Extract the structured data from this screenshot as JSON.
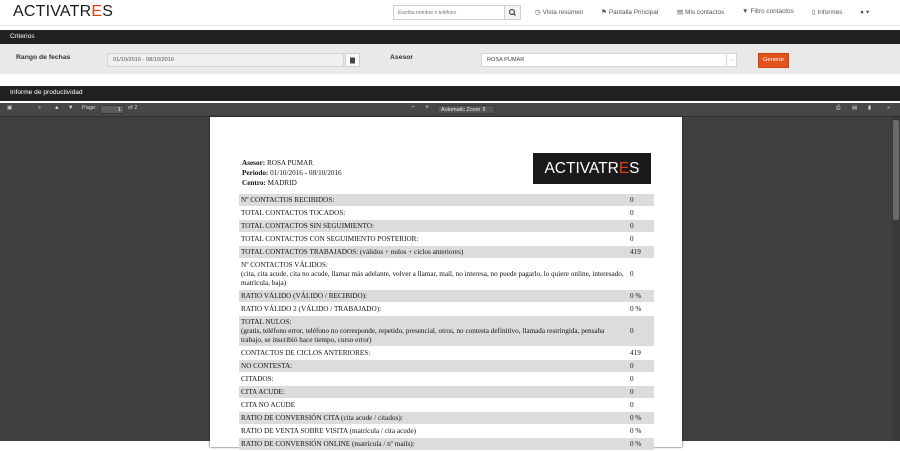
{
  "navbar": {
    "logo_main": "ACTIVATR",
    "logo_accent": "E",
    "logo_tail": "S",
    "search_placeholder": "Escriba nombre o teléfono",
    "items": [
      {
        "label": "Vista resúmen",
        "icon": "clock-icon"
      },
      {
        "label": "Pantalla Principal",
        "icon": "flag-icon"
      },
      {
        "label": "Mis contactos",
        "icon": "list-icon"
      },
      {
        "label": "Filtro contactos",
        "icon": "filter-icon"
      },
      {
        "label": "Informes",
        "icon": "document-icon"
      }
    ],
    "user_icon": "user-icon",
    "user_caret": "▾"
  },
  "criterios": {
    "title": "Criterios",
    "date_range_label": "Rango de fechas",
    "date_range_value": "01/10/2016 - 08/10/2016",
    "advisor_label": "Asesor",
    "advisor_value": "ROSA PUMAR",
    "generate_label": "Generar"
  },
  "informe": {
    "title": "Informe de productividad"
  },
  "pdf_toolbar": {
    "page_label": "Page:",
    "page_current": "1",
    "page_total": "of 2",
    "zoom_value": "Automatic Zoom",
    "zoom_out": "−",
    "zoom_in": "+"
  },
  "report": {
    "asesor_label": "Asesor:",
    "asesor_value": "ROSA PUMAR",
    "periodo_label": "Periodo:",
    "periodo_value": "01/10/2016 - 08/10/2016",
    "centro_label": "Centro:",
    "centro_value": "MADRID",
    "logo_main": "ACTIVATR",
    "logo_accent": "E",
    "logo_tail": "S",
    "rows": [
      {
        "label": "Nº CONTACTOS RECIBIDOS:",
        "detail": "",
        "value": "0"
      },
      {
        "label": "TOTAL CONTACTOS TOCADOS:",
        "detail": "",
        "value": "0"
      },
      {
        "label": "TOTAL CONTACTOS SIN SEGUIMIENTO:",
        "detail": "",
        "value": "0"
      },
      {
        "label": "TOTAL CONTACTOS CON SEGUIMIENTO POSTERIOR:",
        "detail": "",
        "value": "0"
      },
      {
        "label": "TOTAL CONTACTOS TRABAJADOS: (válidos + nulos + ciclos anteriores)",
        "detail": "",
        "value": "419"
      },
      {
        "label": "Nº CONTACTOS VÁLIDOS:",
        "detail": "(cita, cita acude, cita no acude, llamar más adelante, volver a llamar, mail, no interesa, no puede pagarlo, lo quiere online, interesado, matrícula, baja)",
        "value": "0"
      },
      {
        "label": "RATIO VÁLIDO (VÁLIDO / RECIBIDO):",
        "detail": "",
        "value": "0 %"
      },
      {
        "label": "RATIO VÁLIDO 2 (VÁLIDO / TRABAJADO):",
        "detail": "",
        "value": "0 %"
      },
      {
        "label": "TOTAL NULOS:",
        "detail": "(gratis, teléfono error, teléfono no corresponde, repetido, presencial, otros, no contesta definitivo, llamada restringida, pensaba trabajo, se inscribió hace tiempo, curso error)",
        "value": "0"
      },
      {
        "label": "CONTACTOS DE CICLOS ANTERIORES:",
        "detail": "",
        "value": "419"
      },
      {
        "label": "NO CONTESTA:",
        "detail": "",
        "value": "0"
      },
      {
        "label": "CITADOS:",
        "detail": "",
        "value": "0"
      },
      {
        "label": "CITA ACUDE:",
        "detail": "",
        "value": "0"
      },
      {
        "label": "CITA NO ACUDE",
        "detail": "",
        "value": "0"
      },
      {
        "label": "RATIO DE CONVERSIÓN CITA (cita acude / citados):",
        "detail": "",
        "value": "0 %"
      },
      {
        "label": "RATIO DE VENTA SOBRE VISITA (matrícula / cita acude)",
        "detail": "",
        "value": "0 %"
      },
      {
        "label": "RATIO DE CONVERSIÓN ONLINE (matrícula / nº mails):",
        "detail": "",
        "value": "0 %"
      }
    ]
  },
  "colors": {
    "accent": "#e4531b",
    "dark_bar": "#222222",
    "pdf_bg": "#404040",
    "row_shade": "#dcdcdc"
  }
}
